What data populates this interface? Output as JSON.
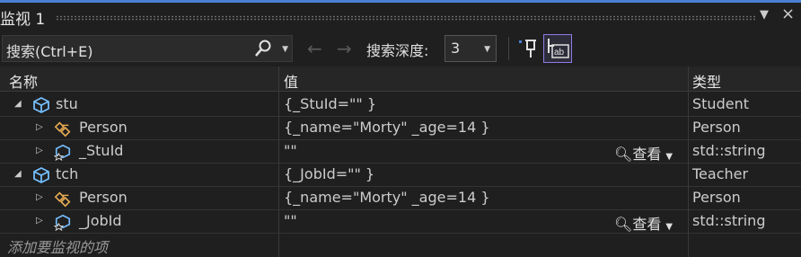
{
  "window": {
    "title": "监视 1"
  },
  "toolbar": {
    "search_placeholder": "搜索(Ctrl+E)",
    "depth_label": "搜索深度:",
    "depth_value": "3"
  },
  "columns": {
    "name": "名称",
    "value": "值",
    "type": "类型"
  },
  "rows": [
    {
      "name": "stu",
      "value": "{_StuId=\"\" }",
      "type": "Student"
    },
    {
      "name": "Person",
      "value": "{_name=\"Morty\" _age=14 }",
      "type": "Person"
    },
    {
      "name": "_StuId",
      "value": "\"\"",
      "view": "查看",
      "type": "std::string"
    },
    {
      "name": "tch",
      "value": "{_JobId=\"\" }",
      "type": "Teacher"
    },
    {
      "name": "Person",
      "value": "{_name=\"Morty\" _age=14 }",
      "type": "Person"
    },
    {
      "name": "_JobId",
      "value": "\"\"",
      "view": "查看",
      "type": "std::string"
    }
  ],
  "add_item_placeholder": "添加要监视的项",
  "colors": {
    "accent": "#4a7fd3",
    "format_button_border": "#8f7ae5"
  }
}
